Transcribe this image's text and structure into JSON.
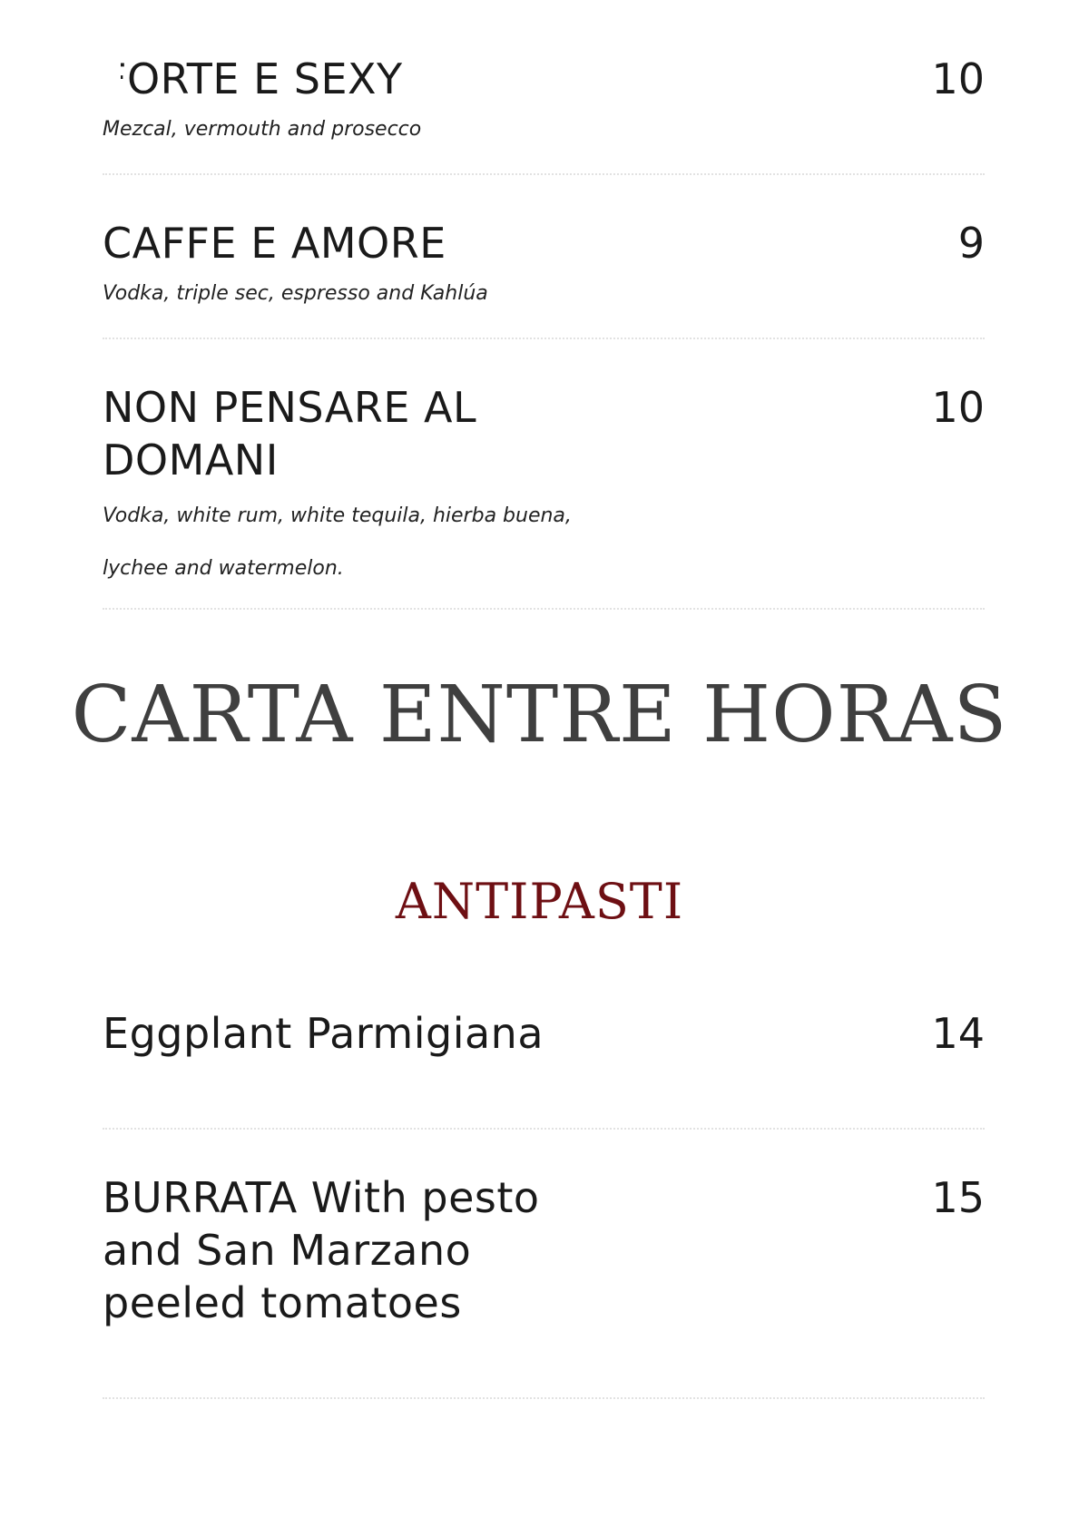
{
  "drinks": [
    {
      "name": "FORTE E SEXY",
      "price": "10",
      "description": [
        "Mezcal, vermouth and prosecco"
      ]
    },
    {
      "name": "CAFFE E AMORE",
      "price": "9",
      "description": [
        "Vodka, triple sec, espresso and Kahlúa"
      ]
    },
    {
      "name": "NON PENSARE AL DOMANI",
      "price": "10",
      "description": [
        "Vodka, white rum, white tequila, hierba buena,",
        "lychee and watermelon."
      ]
    }
  ],
  "section": {
    "title": "CARTA ENTRE HORAS",
    "subtitle": "ANTIPASTI"
  },
  "food": [
    {
      "name": "Eggplant Parmigiana",
      "price": "14"
    },
    {
      "name": "BURRATA With pesto and San Marzano peeled tomatoes",
      "price": "15"
    }
  ]
}
